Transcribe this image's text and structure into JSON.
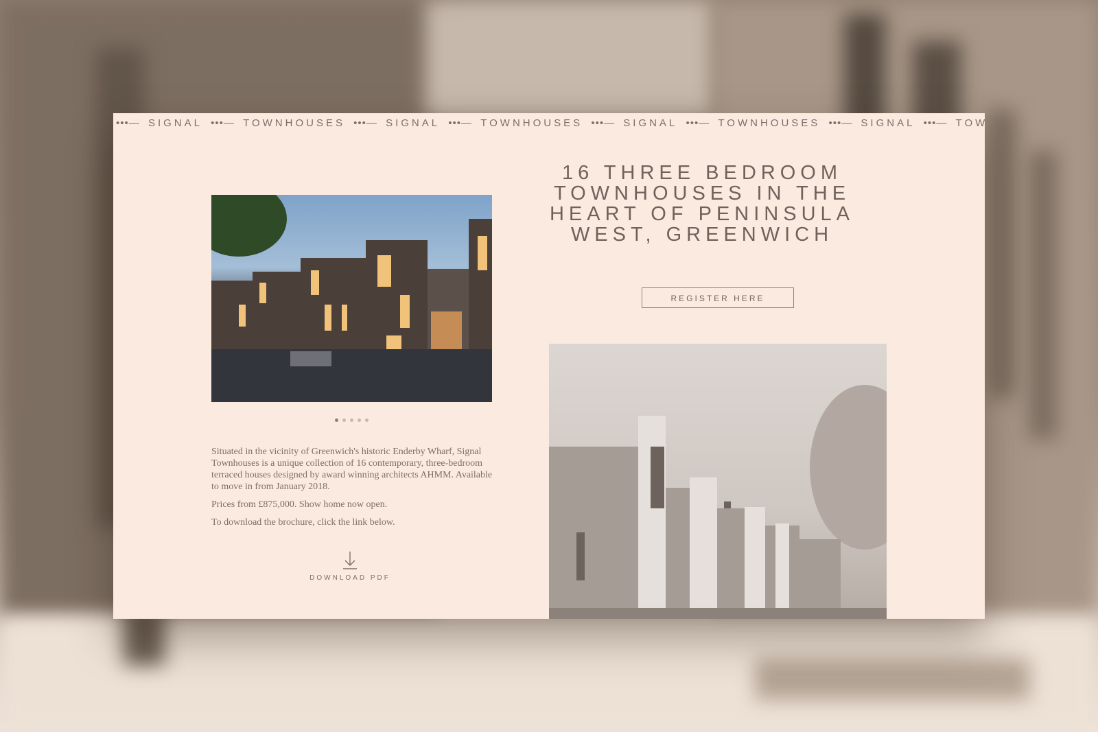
{
  "marquee": {
    "items": [
      "SIGNAL",
      "TOWNHOUSES",
      "SIGNAL",
      "TOWNHOUSES",
      "SIGNAL",
      "TOWNHOUSES",
      "SIGNAL",
      "TOWNHOUS"
    ],
    "separator": "•••—"
  },
  "gallery": {
    "image_alt": "Evening exterior of Signal Townhouses",
    "dot_count": 5,
    "active_dot": 1
  },
  "description": {
    "paragraph_1": "Situated in the vicinity of Greenwich's historic Enderby Wharf, Signal Townhouses is a unique collection of 16 contemporary, three-bedroom terraced houses designed by award winning architects AHMM. Available to move in from January 2018.",
    "paragraph_2": "Prices from £875,000. Show home now open.",
    "paragraph_3": "To download the brochure, click the link below."
  },
  "download": {
    "label": "DOWNLOAD PDF",
    "icon": "download-arrow-icon"
  },
  "headline": {
    "text": "16 THREE BEDROOM TOWNHOUSES IN THE HEART OF PENINSULA WEST, GREENWICH"
  },
  "cta": {
    "register_label": "REGISTER HERE"
  },
  "colors": {
    "card_background": "#fbeae0",
    "text": "#6e625c",
    "muted_text": "#7c6f67"
  }
}
